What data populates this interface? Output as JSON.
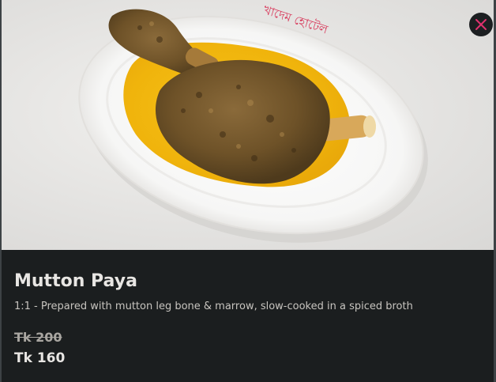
{
  "modal": {
    "image": {
      "alt": "Mutton Paya dish on white plate",
      "plate_brand": "খাদেম হোটেল"
    },
    "close_icon": "close-x-icon",
    "item": {
      "name": "Mutton Paya",
      "description": "1:1 - Prepared with mutton leg bone & marrow, slow-cooked in a spiced broth",
      "original_price": "Tk 200",
      "price": "Tk 160"
    },
    "colors": {
      "close_accent": "#e0316e",
      "panel_bg": "#1b1e1f"
    }
  }
}
